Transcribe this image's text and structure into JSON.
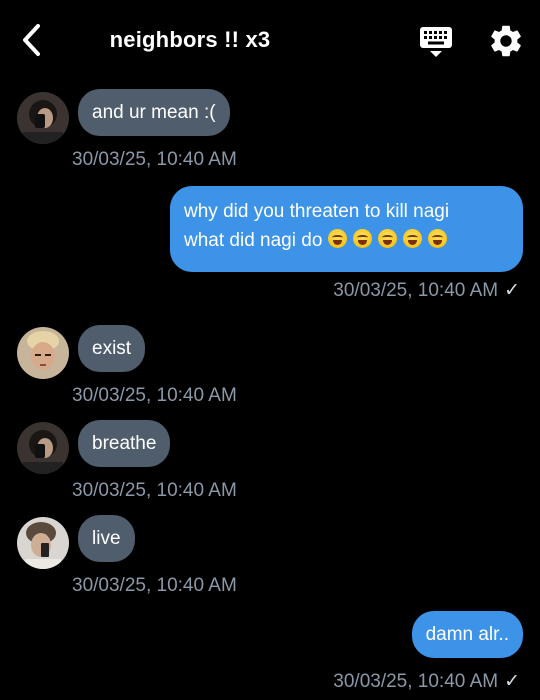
{
  "header": {
    "title": "neighbors !! x3",
    "back_icon": "chevron-left-icon",
    "keyboard_icon": "keyboard-icon",
    "settings_icon": "gear-icon"
  },
  "colors": {
    "background": "#000000",
    "incoming_bubble": "#4f5d6c",
    "outgoing_bubble": "#3d93e8",
    "timestamp": "#8a98a8"
  },
  "messages": [
    {
      "direction": "incoming",
      "text": "and ur mean :(",
      "time": "30/03/25, 10:40 AM",
      "avatar": "dark-haired-avatar"
    },
    {
      "direction": "outgoing",
      "line1": "why did you threaten to kill nagi",
      "line2": "what did nagi do",
      "emoji_count": 5,
      "time": "30/03/25, 10:40 AM",
      "status": "✓"
    },
    {
      "direction": "incoming",
      "text": "exist",
      "time": "30/03/25, 10:40 AM",
      "avatar": "blond-avatar"
    },
    {
      "direction": "incoming",
      "text": "breathe",
      "time": "30/03/25, 10:40 AM",
      "avatar": "dark-haired-avatar"
    },
    {
      "direction": "incoming",
      "text": "live",
      "time": "30/03/25, 10:40 AM",
      "avatar": "brown-haired-avatar"
    },
    {
      "direction": "outgoing",
      "text": "damn alr..",
      "time": "30/03/25, 10:40 AM",
      "status": "✓"
    }
  ]
}
